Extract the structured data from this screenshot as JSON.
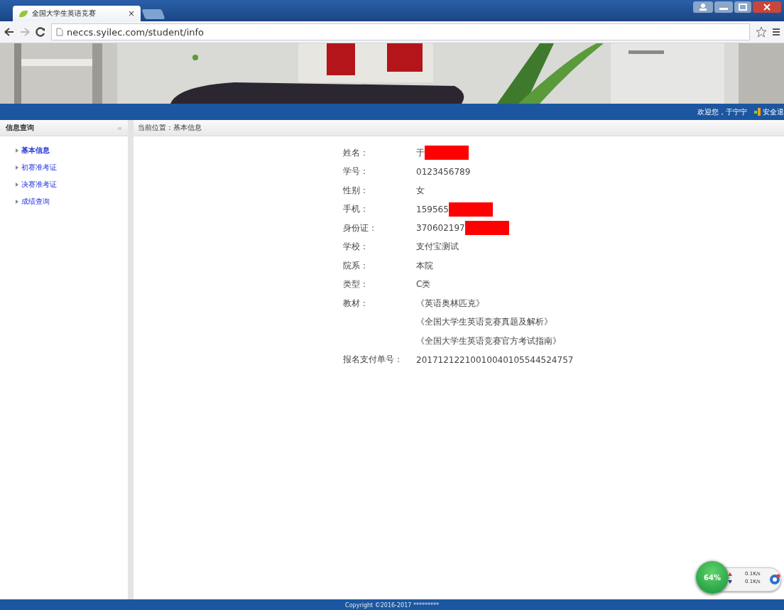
{
  "browser": {
    "tab_title": "全国大学生英语竞赛",
    "tab_close": "×",
    "url": "neccs.syilec.com/student/info"
  },
  "header": {
    "welcome": "欢迎您，于宁宁",
    "logout": "安全退"
  },
  "sidebar": {
    "title": "信息查询",
    "collapse": "«",
    "items": [
      {
        "label": "基本信息",
        "selected": true
      },
      {
        "label": "初赛准考证",
        "selected": false
      },
      {
        "label": "决赛准考证",
        "selected": false
      },
      {
        "label": "成绩查询",
        "selected": false
      }
    ]
  },
  "breadcrumb": "当前位置：基本信息",
  "info": [
    {
      "label": "姓名：",
      "values": [
        "于"
      ],
      "redacted": true
    },
    {
      "label": "学号：",
      "values": [
        "0123456789"
      ],
      "redacted": false
    },
    {
      "label": "性别：",
      "values": [
        "女"
      ],
      "redacted": false
    },
    {
      "label": "手机：",
      "values": [
        "159565"
      ],
      "redacted": true
    },
    {
      "label": "身份证：",
      "values": [
        "370602197"
      ],
      "redacted": true
    },
    {
      "label": "学校：",
      "values": [
        "支付宝测试"
      ],
      "redacted": false
    },
    {
      "label": "院系：",
      "values": [
        "本院"
      ],
      "redacted": false
    },
    {
      "label": "类型：",
      "values": [
        "C类"
      ],
      "redacted": false
    },
    {
      "label": "教材：",
      "values": [
        "《英语奥林匹克》",
        "《全国大学生英语竞赛真题及解析》",
        "《全国大学生英语竞赛官方考试指南》"
      ],
      "redacted": false
    },
    {
      "label": "报名支付单号：",
      "values": [
        "20171212210010040105544524757"
      ],
      "redacted": false
    }
  ],
  "net_widget": {
    "percent": "64%",
    "upload": "0.1K/s",
    "download": "0.1K/s"
  },
  "footer": "Copyright ©2016-2017 *********"
}
